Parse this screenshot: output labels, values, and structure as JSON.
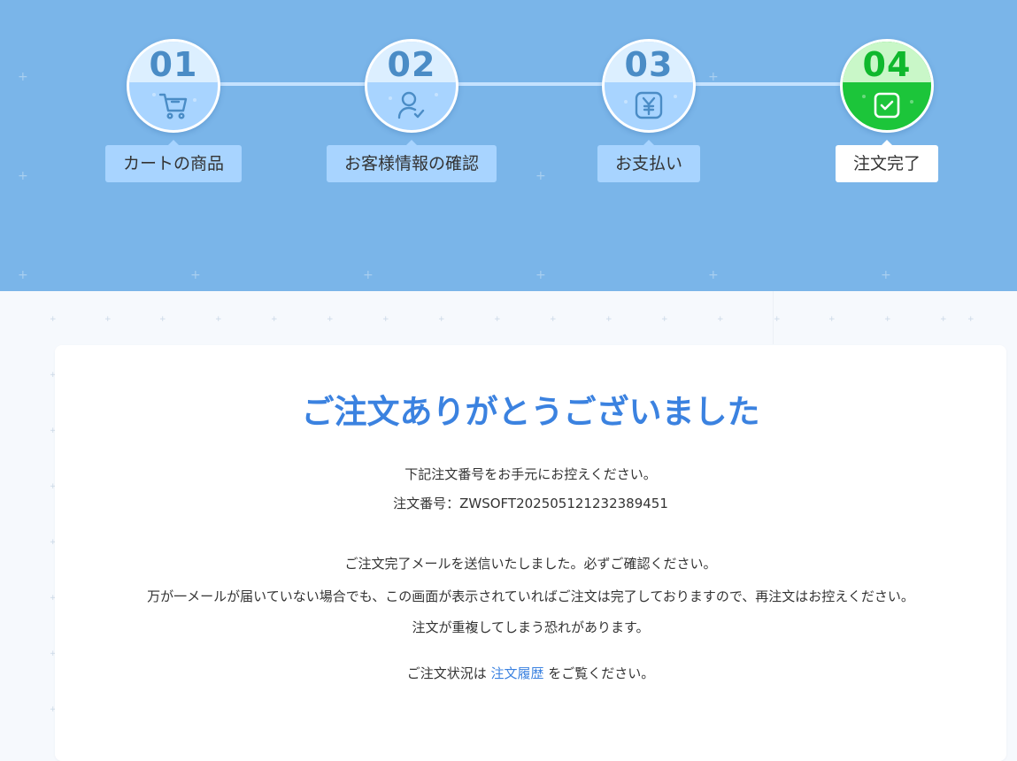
{
  "steps": [
    {
      "number": "01",
      "label": "カートの商品",
      "icon": "cart-icon",
      "state": "done"
    },
    {
      "number": "02",
      "label": "お客様情報の確認",
      "icon": "user-check-icon",
      "state": "done"
    },
    {
      "number": "03",
      "label": "お支払い",
      "icon": "yen-icon",
      "state": "done"
    },
    {
      "number": "04",
      "label": "注文完了",
      "icon": "check-square-icon",
      "state": "current"
    }
  ],
  "colors": {
    "header": "#7ab5e9",
    "step_fill": "#a8d4ff",
    "current_step": "#1cc53a",
    "accent": "#3b82e0"
  },
  "confirmation": {
    "title": "ご注文ありがとうございました",
    "keep_number_note": "下記注文番号をお手元にお控えください。",
    "order_number_label": "注文番号：",
    "order_number": "ZWSOFT20250512123238945​1",
    "email_sent": "ご注文完了メールを送信いたしました。必ずご確認ください。",
    "no_email_note": "万が一メールが届いていない場合でも、この画面が表示されていればご注文は完了しておりますので、再注文はお控えください。",
    "duplicate_warning": "注文が重複してしまう恐れがあります。",
    "status_prefix": "ご注文状況は ",
    "status_link": "注文履歴",
    "status_suffix": " をご覧ください。"
  }
}
